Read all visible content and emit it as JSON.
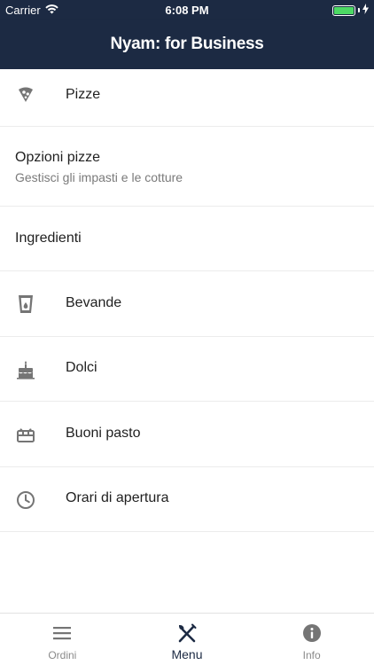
{
  "status_bar": {
    "carrier": "Carrier",
    "time": "6:08 PM"
  },
  "header": {
    "title": "Nyam: for Business"
  },
  "menu": {
    "items": [
      {
        "label": "Pizze",
        "icon": "pizza-icon"
      },
      {
        "label": "Opzioni pizze",
        "sublabel": "Gestisci gli impasti e le cotture"
      },
      {
        "label": "Ingredienti"
      },
      {
        "label": "Bevande",
        "icon": "drink-icon"
      },
      {
        "label": "Dolci",
        "icon": "cake-icon"
      },
      {
        "label": "Buoni pasto",
        "icon": "voucher-icon"
      },
      {
        "label": "Orari di apertura",
        "icon": "clock-icon"
      }
    ]
  },
  "tabs": [
    {
      "label": "Ordini",
      "icon": "list-icon",
      "active": false
    },
    {
      "label": "Menu",
      "icon": "cutlery-icon",
      "active": true
    },
    {
      "label": "Info",
      "icon": "info-icon",
      "active": false
    }
  ],
  "colors": {
    "header_bg": "#1c2a43",
    "icon_gray": "#757575",
    "battery_green": "#4cd964"
  }
}
